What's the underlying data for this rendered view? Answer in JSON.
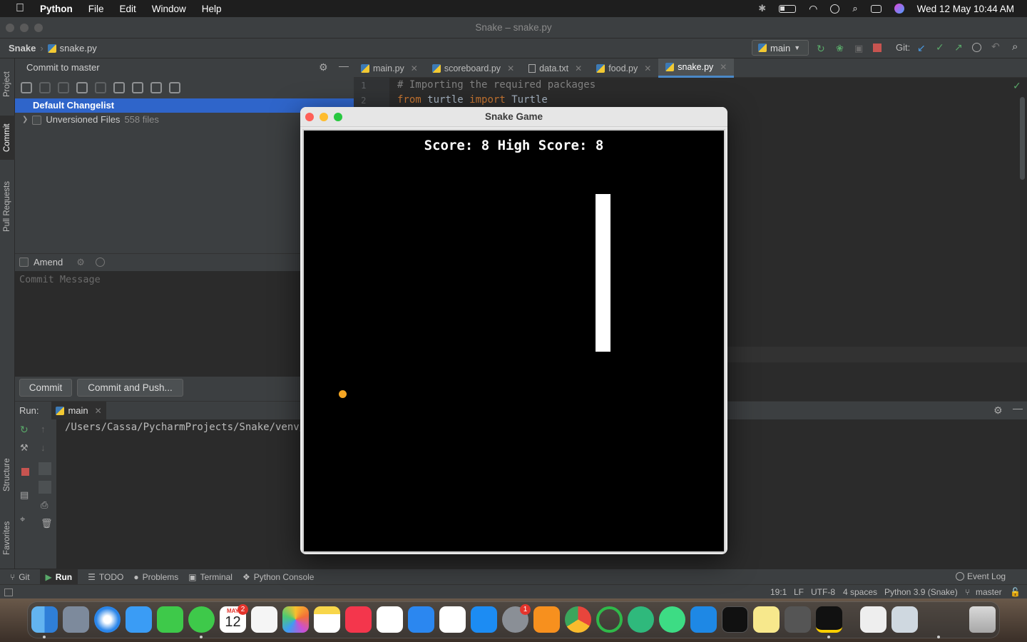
{
  "menubar": {
    "app_name": "Python",
    "items": [
      "File",
      "Edit",
      "Window",
      "Help"
    ],
    "clock": "Wed 12 May  10:44 AM"
  },
  "window": {
    "title": "Snake – snake.py"
  },
  "navbar": {
    "project": "Snake",
    "file": "snake.py",
    "run_config": "main",
    "git_label": "Git:"
  },
  "left_stripe": {
    "project": "Project",
    "commit": "Commit",
    "pull_requests": "Pull Requests",
    "structure": "Structure",
    "favorites": "Favorites"
  },
  "commit_panel": {
    "title": "Commit to master",
    "changelist": "Default Changelist",
    "unversioned_label": "Unversioned Files",
    "unversioned_count": "558 files",
    "amend": "Amend",
    "commit_placeholder": "Commit Message",
    "commit_button": "Commit",
    "commit_push_button": "Commit and Push..."
  },
  "editor": {
    "tabs": [
      "main.py",
      "scoreboard.py",
      "data.txt",
      "food.py",
      "snake.py"
    ],
    "active_tab": "snake.py",
    "lines": [
      {
        "num": "1",
        "comment": "# Importing the required packages"
      },
      {
        "num": "2",
        "kw1": "from",
        "mod": "turtle",
        "kw2": "import",
        "name": "Turtle"
      }
    ]
  },
  "run_panel": {
    "label": "Run:",
    "config": "main",
    "output": "/Users/Cassa/PycharmProjects/Snake/venv/b"
  },
  "bottom_tabs": [
    "Git",
    "Run",
    "TODO",
    "Problems",
    "Terminal",
    "Python Console"
  ],
  "event_log": "Event Log",
  "status": {
    "position": "19:1",
    "line_sep": "LF",
    "encoding": "UTF-8",
    "indent": "4 spaces",
    "interpreter": "Python 3.9 (Snake)",
    "branch": "master"
  },
  "game": {
    "title": "Snake Game",
    "score_text": "Score: 8 High Score: 8",
    "colors": {
      "background": "#000000",
      "snake": "#ffffff",
      "food": "#f5a623"
    }
  },
  "dock": {
    "calendar_month": "MAY",
    "calendar_day": "12",
    "calendar_badge": "2",
    "settings_badge": "1"
  }
}
